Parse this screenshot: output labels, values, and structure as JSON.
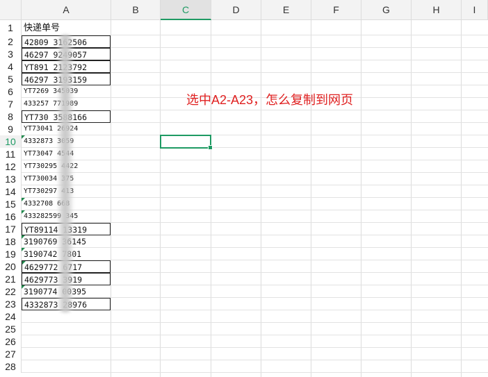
{
  "columns": [
    "A",
    "B",
    "C",
    "D",
    "E",
    "F",
    "G",
    "H",
    "I"
  ],
  "selected_column": "C",
  "rows": [
    "1",
    "2",
    "3",
    "4",
    "5",
    "6",
    "7",
    "8",
    "9",
    "10",
    "11",
    "12",
    "13",
    "14",
    "15",
    "16",
    "17",
    "18",
    "19",
    "20",
    "21",
    "22",
    "23",
    "24",
    "25",
    "26",
    "27",
    "28"
  ],
  "selected_row": "10",
  "sheet": {
    "a1_header": "快递单号",
    "column_a_values": [
      "42809   3162506",
      "46297   9249057",
      "YT891   2123792",
      "46297   3193159",
      "YT7269   345039",
      "433257   771989",
      "YT730   3588166",
      "YT73041   26924",
      "4332873   3059",
      "YT73047   4544",
      "YT730295   4422",
      "YT730034   375",
      "YT730297   413",
      "4332708   668",
      "433282599   345",
      "YT89114   13319",
      "3190769   36145",
      "3190742   7801",
      "4629772   6717",
      "4629773   3919",
      "3190774   00395",
      "4332873   28976"
    ]
  },
  "annotation": "选中A2-A23，怎么复制到网页"
}
